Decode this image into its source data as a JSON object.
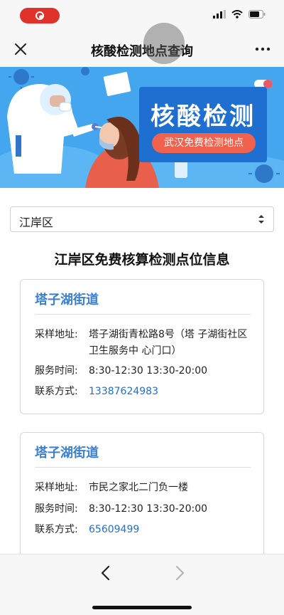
{
  "nav": {
    "title": "核酸检测地点查询"
  },
  "banner": {
    "title": "核酸检测",
    "subtitle": "武汉免费检测地点"
  },
  "district_select": {
    "selected": "江岸区"
  },
  "section_title": "江岸区免费核算检测点位信息",
  "cards": [
    {
      "name": "塔子湖街道",
      "address_label": "采样地址:",
      "address": "塔子湖街青松路8号（塔 子湖街社区卫生服务中 心门口）",
      "hours_label": "服务时间:",
      "hours": "8:30-12:30 13:30-20:00",
      "phone_label": "联系方式:",
      "phone": "13387624983"
    },
    {
      "name": "塔子湖街道",
      "address_label": "采样地址:",
      "address": "市民之家北二门负一楼",
      "hours_label": "服务时间:",
      "hours": "8:30-12:30 13:30-20:00",
      "phone_label": "联系方式:",
      "phone": "65609499"
    }
  ],
  "colors": {
    "accent_blue": "#3a7fd0",
    "link_blue": "#1f6fd1",
    "banner_bg": "#43a6ee",
    "badge_red": "#f0624e",
    "record_red": "#e0322a"
  },
  "icons": {
    "status": [
      "screen-record-icon",
      "signal-icon",
      "wifi-icon",
      "battery-icon"
    ],
    "nav": [
      "close-icon",
      "more-icon"
    ],
    "select": "chevron-updown-icon",
    "toolbar": [
      "back-arrow-icon",
      "forward-arrow-icon"
    ]
  }
}
